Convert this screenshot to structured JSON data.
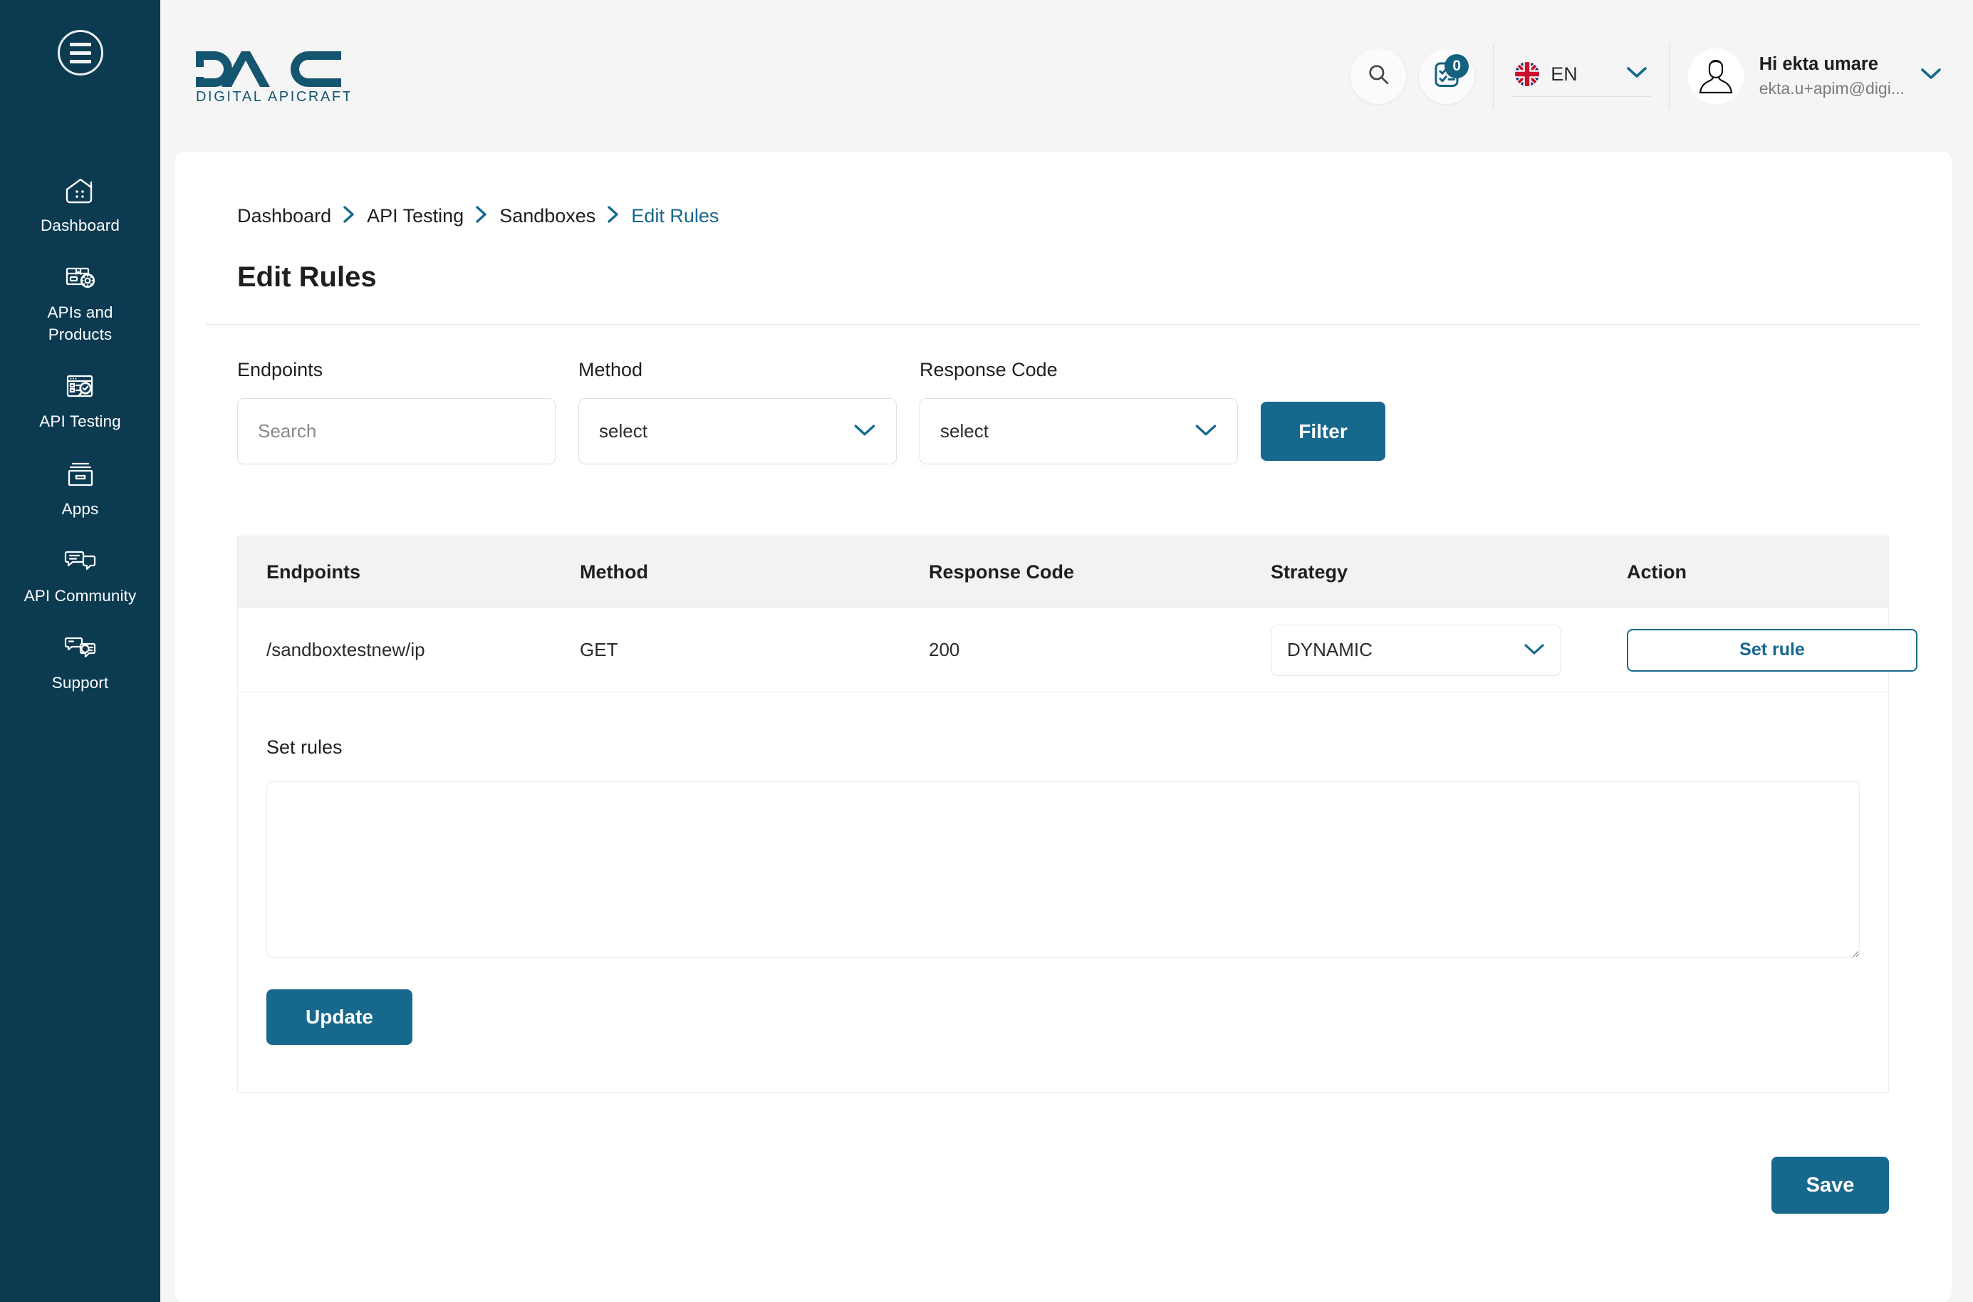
{
  "brand": {
    "logo_text": "DAC",
    "logo_tagline": "DIGITAL APICRAFT",
    "accent_color": "#17688d",
    "sidebar_color": "#0b3a51"
  },
  "sidebar": {
    "menu_toggle": "menu-toggle",
    "items": [
      {
        "label": "Dashboard",
        "icon": "home-dashboard-icon"
      },
      {
        "label": "APIs and\nProducts",
        "icon": "box-gear-icon"
      },
      {
        "label": "API Testing",
        "icon": "document-search-icon"
      },
      {
        "label": "Apps",
        "icon": "archive-box-icon"
      },
      {
        "label": "API Community",
        "icon": "chat-bubbles-icon"
      },
      {
        "label": "Support",
        "icon": "headset-chat-icon"
      }
    ]
  },
  "header": {
    "search_icon": "search-icon",
    "tasks_icon": "checklist-icon",
    "tasks_badge": "0",
    "language": {
      "code": "EN",
      "flag": "uk-flag"
    },
    "user": {
      "greeting": "Hi ekta umare",
      "email": "ekta.u+apim@digi...",
      "avatar": "user-avatar"
    }
  },
  "breadcrumb": {
    "items": [
      {
        "label": "Dashboard",
        "active": false
      },
      {
        "label": "API Testing",
        "active": false
      },
      {
        "label": "Sandboxes",
        "active": false
      },
      {
        "label": "Edit Rules",
        "active": true
      }
    ],
    "separator": "›"
  },
  "page": {
    "title": "Edit Rules"
  },
  "filters": {
    "endpoints": {
      "label": "Endpoints",
      "placeholder": "Search",
      "value": ""
    },
    "method": {
      "label": "Method",
      "value": "select"
    },
    "response_code": {
      "label": "Response Code",
      "value": "select"
    },
    "filter_button": "Filter"
  },
  "table": {
    "columns": [
      "Endpoints",
      "Method",
      "Response Code",
      "Strategy",
      "Action"
    ],
    "rows": [
      {
        "endpoint": "/sandboxtestnew/ip",
        "method": "GET",
        "response_code": "200",
        "strategy": "DYNAMIC",
        "action_label": "Set rule"
      }
    ]
  },
  "set_rules": {
    "label": "Set rules",
    "textarea_value": "",
    "update_button": "Update"
  },
  "footer": {
    "save_button": "Save"
  }
}
